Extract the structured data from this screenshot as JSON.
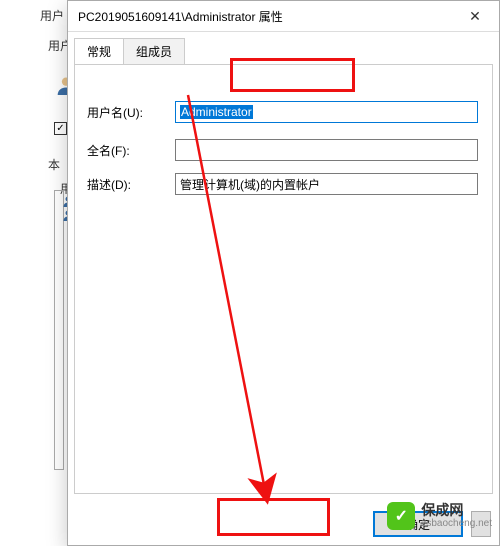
{
  "bg": {
    "title": "用户",
    "col": "用户",
    "local": "本",
    "groupLabel": "用",
    "checked": true
  },
  "dlg": {
    "title": "PC2019051609141\\Administrator 属性",
    "close": "✕",
    "tabs": {
      "general": "常规",
      "members": "组成员"
    },
    "labels": {
      "user": "用户名(U):",
      "full": "全名(F):",
      "desc": "描述(D):"
    },
    "values": {
      "user": "Administrator",
      "full": "",
      "desc": "管理计算机(域)的内置帐户"
    },
    "buttons": {
      "ok": "确定"
    }
  },
  "watermark": {
    "badge": "✓",
    "cn": "保成网",
    "url": "zsbaocheng.net"
  }
}
